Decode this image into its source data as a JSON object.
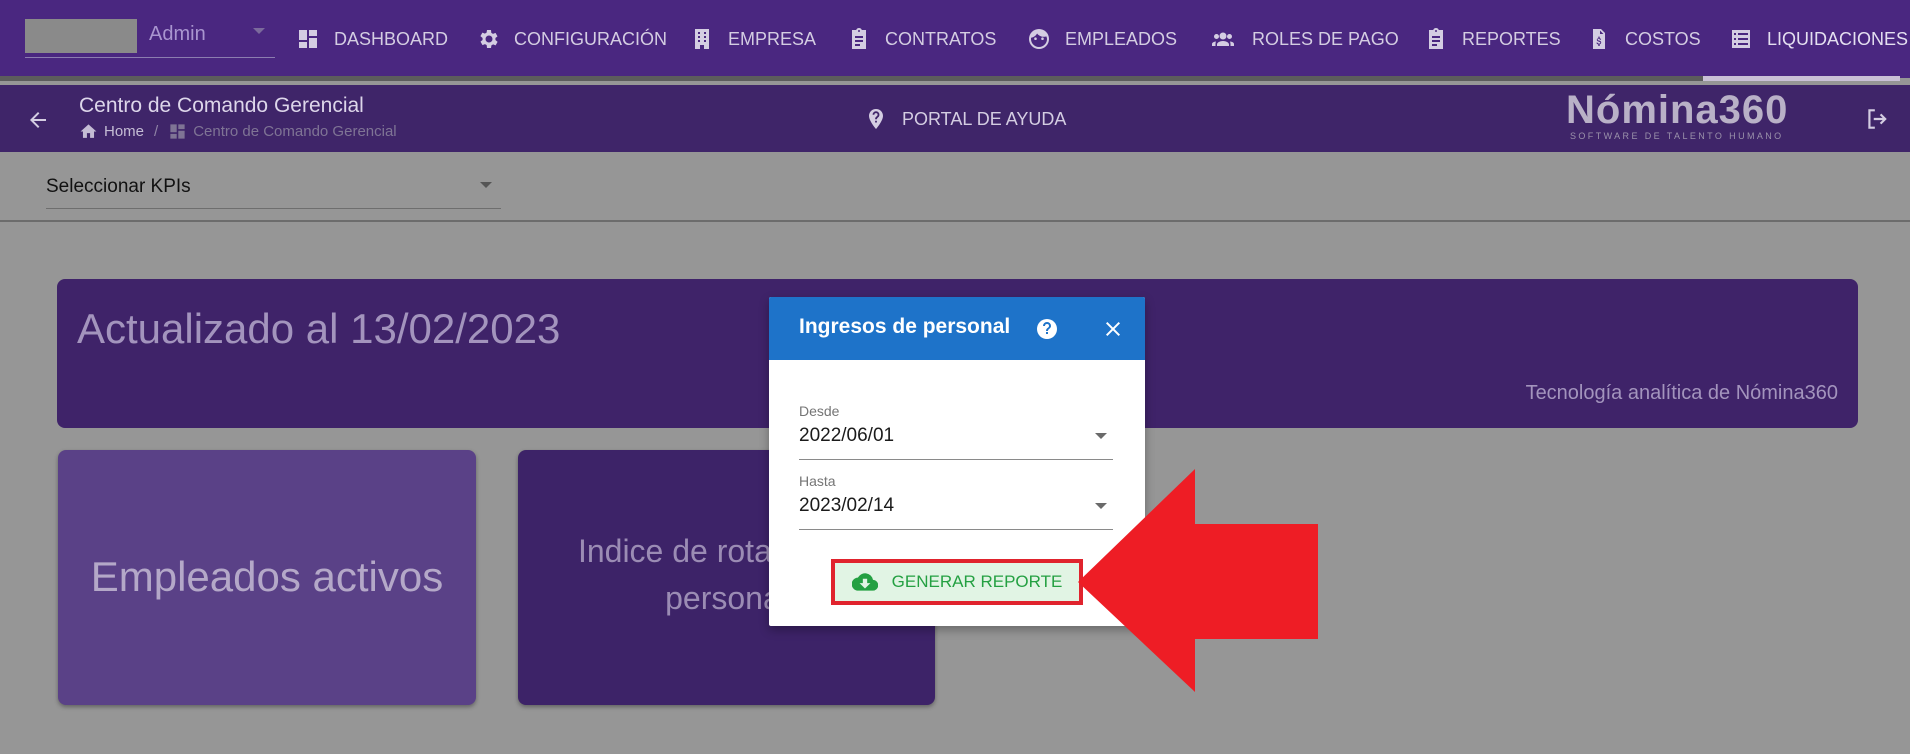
{
  "nav": {
    "user": {
      "name": "Admin"
    },
    "items": [
      {
        "label": "DASHBOARD",
        "icon": "dashboard-icon"
      },
      {
        "label": "CONFIGURACIÓN",
        "icon": "gear-icon"
      },
      {
        "label": "EMPRESA",
        "icon": "building-icon"
      },
      {
        "label": "CONTRATOS",
        "icon": "clipboard-icon"
      },
      {
        "label": "EMPLEADOS",
        "icon": "face-icon"
      },
      {
        "label": "ROLES DE PAGO",
        "icon": "group-icon"
      },
      {
        "label": "REPORTES",
        "icon": "clipboard-icon"
      },
      {
        "label": "COSTOS",
        "icon": "invoice-icon"
      },
      {
        "label": "LIQUIDACIONES",
        "icon": "list-icon"
      }
    ],
    "active_item": "LIQUIDACIONES"
  },
  "subheader": {
    "title": "Centro de Comando Gerencial",
    "breadcrumb": {
      "home": "Home",
      "separator": "/",
      "current": "Centro de Comando Gerencial"
    },
    "help_link": "PORTAL DE AYUDA",
    "logo": {
      "name": "Nómina360",
      "tagline": "SOFTWARE DE TALENTO HUMANO"
    }
  },
  "kpi_selector": {
    "label": "Seleccionar KPIs"
  },
  "banner": {
    "title": "Actualizado al 13/02/2023",
    "subtitle": "Tecnología analítica de Nómina360"
  },
  "cards": [
    {
      "text": "Empleados activos"
    },
    {
      "line1": "Indice de rotación de",
      "line2": "personal"
    }
  ],
  "modal": {
    "title": "Ingresos de personal",
    "fields": [
      {
        "label": "Desde",
        "value": "2022/06/01"
      },
      {
        "label": "Hasta",
        "value": "2023/02/14"
      }
    ],
    "button_label": "GENERAR REPORTE"
  },
  "colors": {
    "nav_bg": "#4a2780",
    "modal_header": "#1e73c9",
    "button_text": "#24a042",
    "highlight": "#e0232d"
  }
}
